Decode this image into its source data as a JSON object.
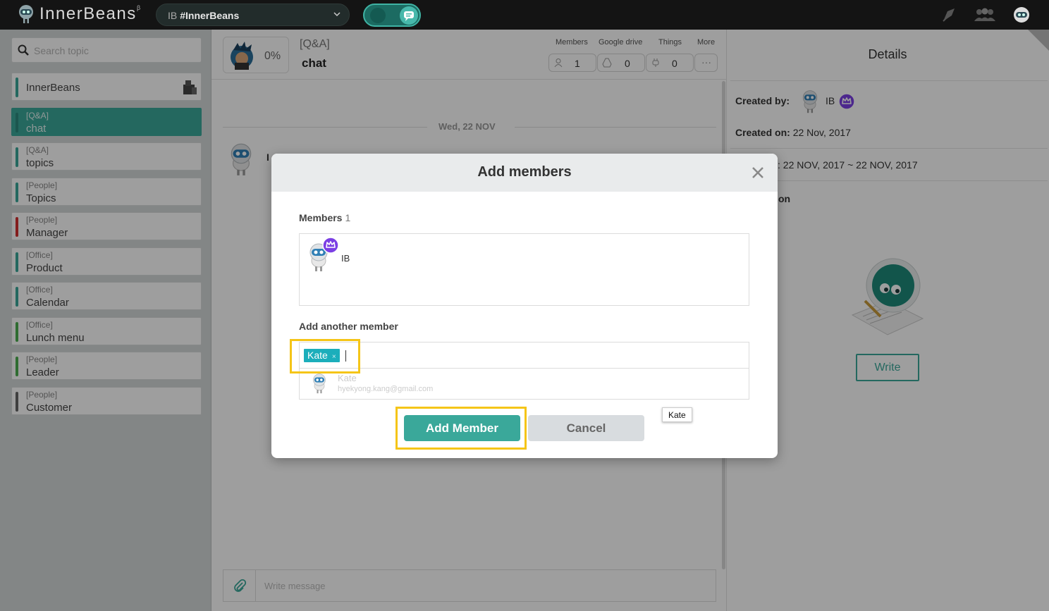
{
  "app": {
    "logo_text": "InnerBeans",
    "beta": "β",
    "workspace_prefix": "IB",
    "workspace_name": "#InnerBeans"
  },
  "sidebar": {
    "search_placeholder": "Search topic",
    "items": [
      {
        "category": "",
        "name": "InnerBeans",
        "color": "#3aa89a"
      },
      {
        "category": "[Q&A]",
        "name": "chat",
        "color": "#3aa89a",
        "active": true
      },
      {
        "category": "[Q&A]",
        "name": "topics",
        "color": "#3aa89a"
      },
      {
        "category": "[People]",
        "name": "Topics",
        "color": "#3aa89a"
      },
      {
        "category": "[People]",
        "name": "Manager",
        "color": "#d32f2f"
      },
      {
        "category": "[Office]",
        "name": "Product",
        "color": "#3aa89a"
      },
      {
        "category": "[Office]",
        "name": "Calendar",
        "color": "#3aa89a"
      },
      {
        "category": "[Office]",
        "name": "Lunch menu",
        "color": "#4caf50"
      },
      {
        "category": "[People]",
        "name": "Leader",
        "color": "#4caf50"
      },
      {
        "category": "[People]",
        "name": "Customer",
        "color": "#666666"
      }
    ]
  },
  "header": {
    "progress": "0%",
    "category": "[Q&A]",
    "title": "chat",
    "tabs": [
      {
        "label": "Members",
        "value": "1",
        "icon": "person-icon"
      },
      {
        "label": "Google drive",
        "value": "0",
        "icon": "drive-icon"
      },
      {
        "label": "Things",
        "value": "0",
        "icon": "plug-icon"
      },
      {
        "label": "More",
        "value": "···",
        "icon": "more-icon"
      }
    ]
  },
  "chat": {
    "date": "Wed, 22 NOV",
    "sender_initial": "I",
    "composer_placeholder": "Write message"
  },
  "details": {
    "title": "Details",
    "created_by_label": "Created by:",
    "created_by_name": "IB",
    "created_on_label": "Created on:",
    "created_on_value": "22 Nov, 2017",
    "period_partial": ": 22 NOV, 2017 ~ 22 NOV, 2017",
    "section_partial": "on",
    "write_button": "Write"
  },
  "modal": {
    "title": "Add members",
    "members_label": "Members",
    "members_count": "1",
    "member_name": "IB",
    "add_label": "Add another member",
    "tag": "Kate",
    "tag_remove": "×",
    "suggestion_name": "Kate",
    "suggestion_email": "hyekyong.kang@gmail.com",
    "add_button": "Add Member",
    "cancel_button": "Cancel",
    "tooltip": "Kate"
  },
  "colors": {
    "accent": "#3aa89a",
    "highlight": "#f5c518",
    "crown": "#7b3fe4",
    "tag": "#1baebb"
  }
}
